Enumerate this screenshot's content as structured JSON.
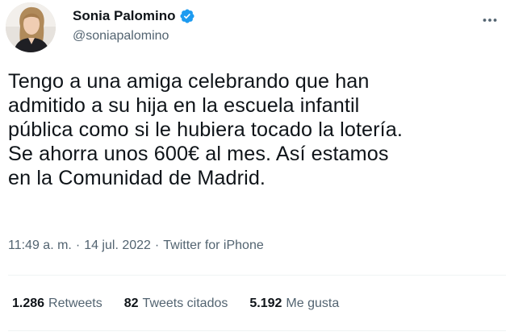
{
  "author": {
    "display_name": "Sonia Palomino",
    "handle": "@soniapalomino",
    "verified": true,
    "avatar_icon": "profile-photo"
  },
  "tweet": {
    "text": "Tengo a una amiga celebrando que han\nadmitido a su hija en la escuela infantil\npública como si le hubiera tocado la lotería.\nSe ahorra unos 600€ al mes. Así estamos\nen la Comunidad de Madrid."
  },
  "meta": {
    "time": "11:49 a. m.",
    "separator1": "·",
    "date": "14 jul. 2022",
    "separator2": "·",
    "source": "Twitter for iPhone"
  },
  "stats": {
    "retweets_count": "1.286",
    "retweets_label": "Retweets",
    "quotes_count": "82",
    "quotes_label": "Tweets citados",
    "likes_count": "5.192",
    "likes_label": "Me gusta"
  },
  "colors": {
    "text": "#0f1419",
    "secondary": "#536471",
    "verified": "#1d9bf0",
    "divider": "#eff3f4"
  }
}
